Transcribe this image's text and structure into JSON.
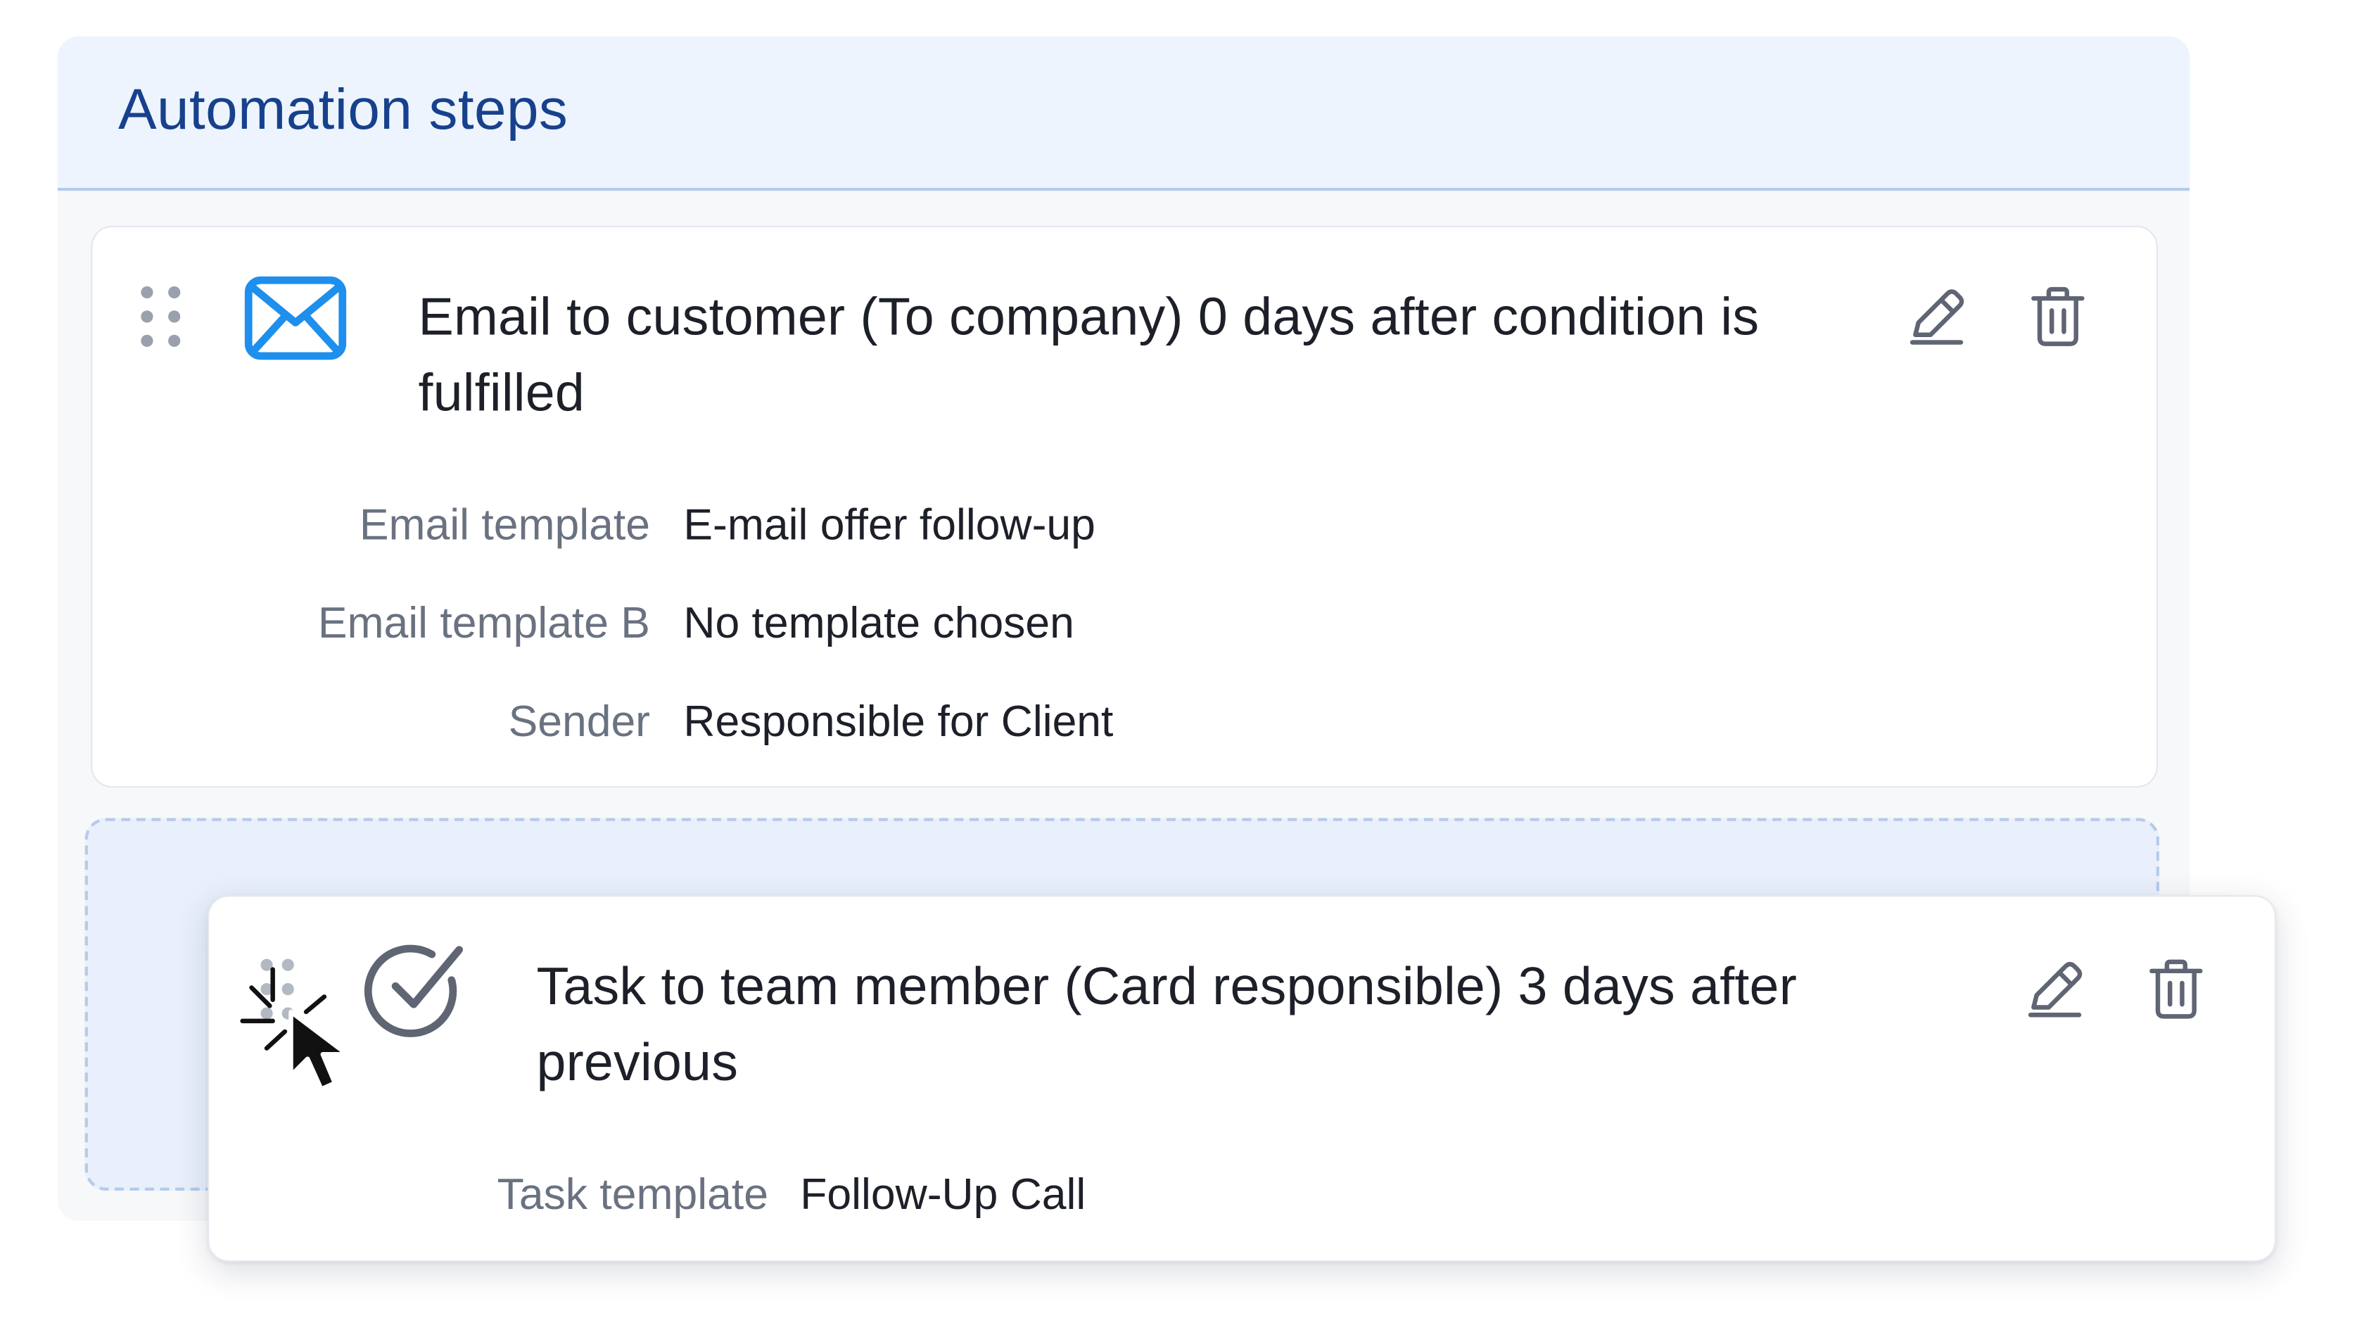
{
  "panel": {
    "title": "Automation steps"
  },
  "steps": [
    {
      "icon": "envelope-icon",
      "title": "Email to customer (To company) 0 days after condition is fulfilled",
      "fields": [
        {
          "label": "Email template",
          "value": "E-mail offer follow-up"
        },
        {
          "label": "Email template B",
          "value": "No template chosen"
        },
        {
          "label": "Sender",
          "value": "Responsible for Client"
        }
      ]
    },
    {
      "icon": "check-circle-icon",
      "title": "Task to team member (Card responsible) 3 days after previous",
      "fields": [
        {
          "label": "Task template",
          "value": "Follow-Up Call"
        }
      ],
      "state": "dragging"
    }
  ],
  "colors": {
    "accent": "#1e8fec",
    "title": "#17418c",
    "header_bg": "#edf4fd",
    "drop_zone_bg": "#e9f0fb",
    "icon_gray": "#5f6573"
  }
}
